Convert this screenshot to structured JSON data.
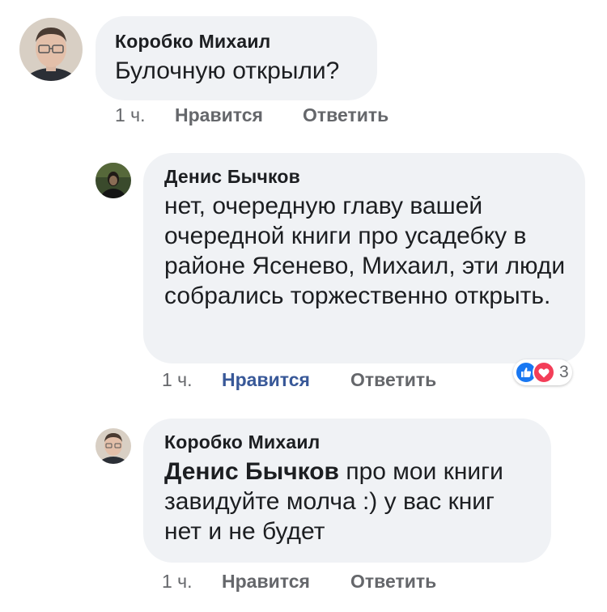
{
  "comments": [
    {
      "author": "Коробко Михаил",
      "text": "Булочную открыли?",
      "time": "1 ч.",
      "like_label": "Нравится",
      "reply_label": "Ответить"
    },
    {
      "author": "Денис Бычков",
      "text": "нет, очередную главу вашей очередной книги про усадебку в районе Ясенево, Михаил, эти люди собрались торжественно открыть.",
      "time": "1 ч.",
      "like_label": "Нравится",
      "reply_label": "Ответить",
      "liked_by_viewer": true,
      "reactions": {
        "icons": [
          "like-icon",
          "love-icon"
        ],
        "count": "3"
      }
    },
    {
      "author": "Коробко Михаил",
      "mention": "Денис Бычков",
      "text": "про мои книги завидуйте молча :) у вас книг нет и не будет",
      "time": "1 ч.",
      "like_label": "Нравится",
      "reply_label": "Ответить"
    }
  ],
  "colors": {
    "bubble_bg": "#f0f2f5",
    "meta_text": "#65676b",
    "like_active": "#385898",
    "like_reaction": "#1877f2",
    "love_reaction": "#f33e58"
  }
}
